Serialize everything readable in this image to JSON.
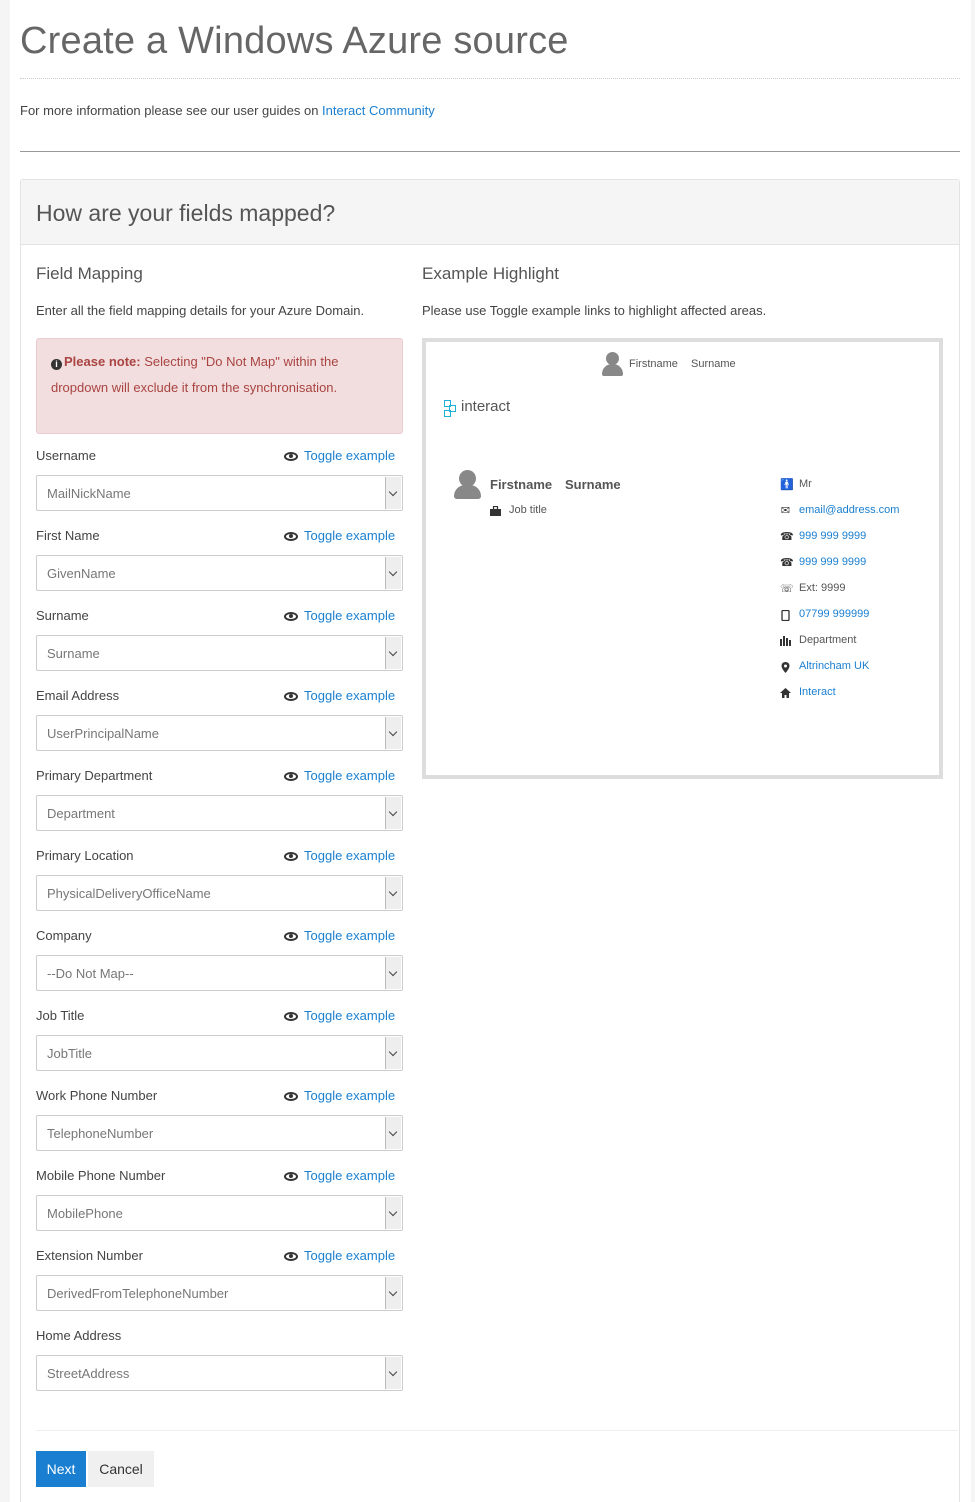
{
  "page": {
    "title": "Create a Windows Azure source",
    "info_prefix": "For more information please see our user guides on ",
    "info_link": "Interact Community"
  },
  "panel": {
    "title": "How are your fields mapped?"
  },
  "mapping": {
    "heading": "Field Mapping",
    "description": "Enter all the field mapping details for your Azure Domain.",
    "note_label": "Please note:",
    "note_text": " Selecting \"Do Not Map\" within the dropdown will exclude it from the synchronisation.",
    "toggle_label": "Toggle example",
    "fields": [
      {
        "label": "Username",
        "value": "MailNickName",
        "toggle": true
      },
      {
        "label": "First Name",
        "value": "GivenName",
        "toggle": true
      },
      {
        "label": "Surname",
        "value": "Surname",
        "toggle": true
      },
      {
        "label": "Email Address",
        "value": "UserPrincipalName",
        "toggle": true
      },
      {
        "label": "Primary Department",
        "value": "Department",
        "toggle": true
      },
      {
        "label": "Primary Location",
        "value": "PhysicalDeliveryOfficeName",
        "toggle": true
      },
      {
        "label": "Company",
        "value": "--Do Not Map--",
        "toggle": true
      },
      {
        "label": "Job Title",
        "value": "JobTitle",
        "toggle": true
      },
      {
        "label": "Work Phone Number",
        "value": "TelephoneNumber",
        "toggle": true
      },
      {
        "label": "Mobile Phone Number",
        "value": "MobilePhone",
        "toggle": true
      },
      {
        "label": "Extension Number",
        "value": "DerivedFromTelephoneNumber",
        "toggle": true
      },
      {
        "label": "Home Address",
        "value": "StreetAddress",
        "toggle": false
      }
    ]
  },
  "example": {
    "heading": "Example Highlight",
    "description": "Please use Toggle example links to highlight affected areas.",
    "header_firstname": "Firstname",
    "header_surname": "Surname",
    "logo_text": "interact",
    "card_firstname": "Firstname",
    "card_surname": "Surname",
    "job_title": "Job title",
    "details": {
      "title": "Mr",
      "email": "email@address.com",
      "phone1": "999 999 9999",
      "phone2": "999 999 9999",
      "ext": "Ext: 9999",
      "mobile": "07799 999999",
      "department": "Department",
      "location": "Altrincham UK",
      "company": "Interact"
    }
  },
  "buttons": {
    "next": "Next",
    "cancel": "Cancel"
  }
}
